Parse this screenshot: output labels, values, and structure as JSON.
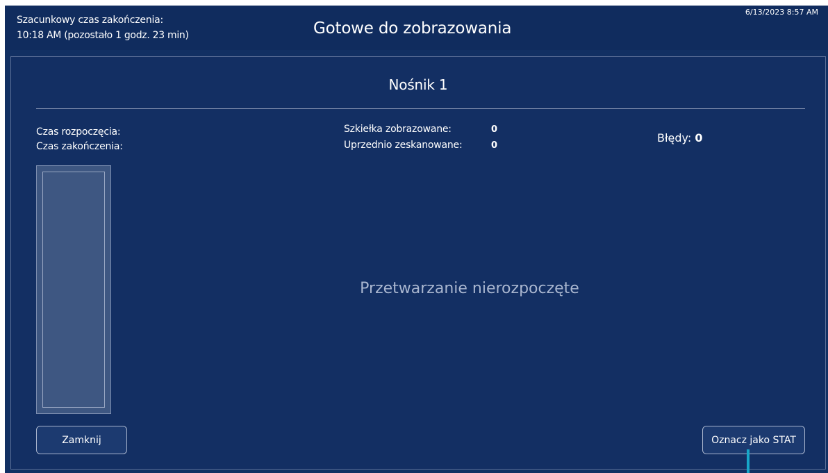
{
  "header": {
    "estimated_label": "Szacunkowy czas zakończenia:",
    "estimated_value": "10:18 AM (pozostało 1 godz. 23 min)",
    "title": "Gotowe do zobrazowania",
    "datetime": "6/13/2023 8:57 AM"
  },
  "panel": {
    "title": "Nośnik 1",
    "start_time_label": "Czas rozpoczęcia:",
    "end_time_label": "Czas zakończenia:",
    "slides_imaged_label": "Szkiełka zobrazowane:",
    "slides_imaged_value": "0",
    "previously_scanned_label": "Uprzednio zeskanowane:",
    "previously_scanned_value": "0",
    "errors_label": "Błędy:",
    "errors_value": "0",
    "status_message": "Przetwarzanie nierozpoczęte"
  },
  "buttons": {
    "close_label": "Zamknij",
    "mark_stat_label": "Oznacz jako STAT"
  },
  "colors": {
    "background": "#123063",
    "header": "#102c5e",
    "slide": "#3e5782",
    "status_text": "#a9b6cf",
    "cursor_indicator": "#17a7c9"
  }
}
